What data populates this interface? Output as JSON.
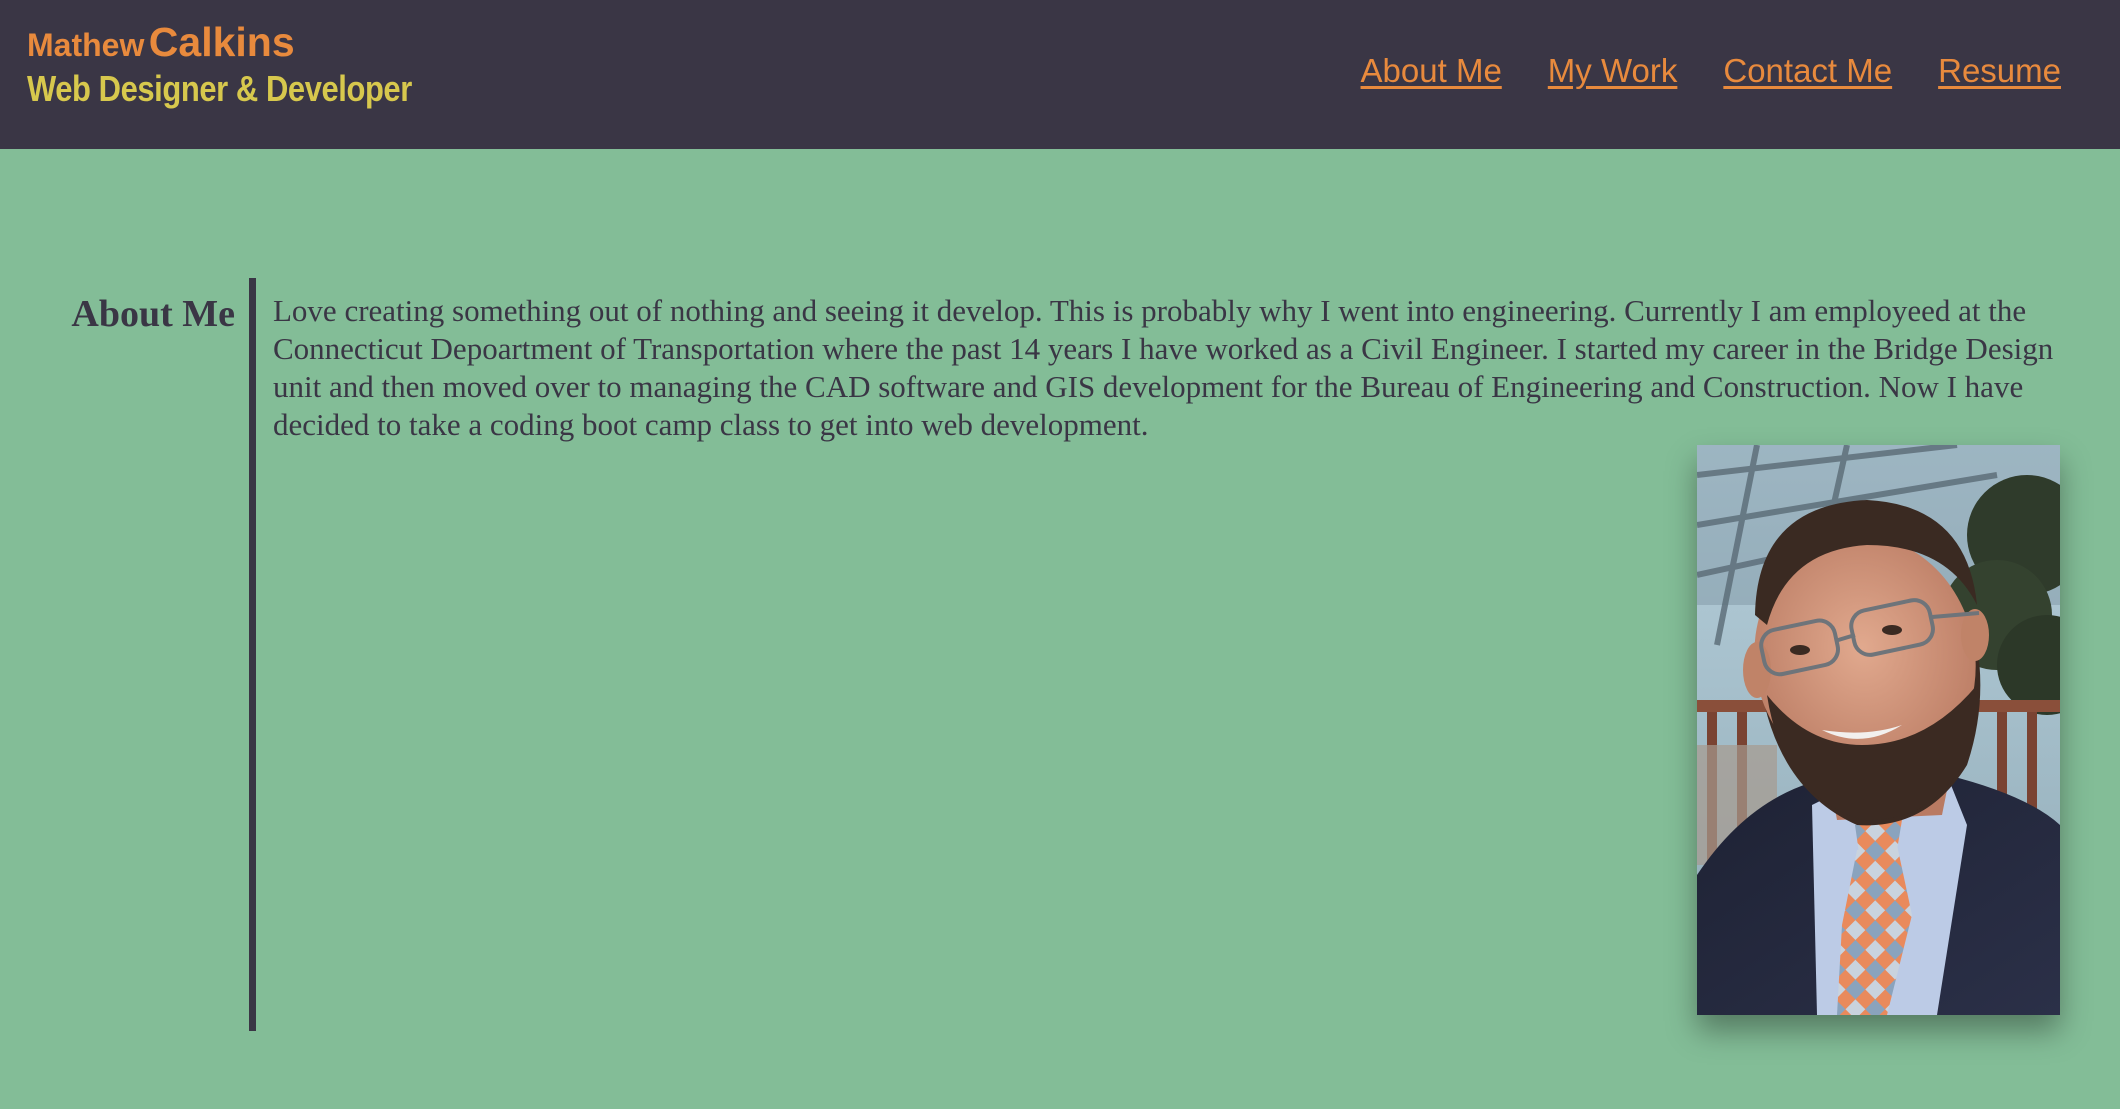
{
  "header": {
    "first_name": "Mathew",
    "last_name": "Calkins",
    "role": "Web Designer & Developer",
    "nav": [
      {
        "label": "About Me"
      },
      {
        "label": "My Work"
      },
      {
        "label": "Contact Me"
      },
      {
        "label": "Resume"
      }
    ]
  },
  "about": {
    "heading": "About Me",
    "text": "Love creating something out of nothing and seeing it develop. This is probably why I went into engineering. Currently I am employeed at the Connecticut Depoartment of Transportation where the past 14 years I have worked as a Civil Engineer. I started my career in the Bridge Design unit and then moved over to managing the CAD software and GIS development for the Bureau of Engineering and Construction. Now I have decided to take a coding boot camp class to get into web development."
  },
  "colors": {
    "header_bg": "#3a3645",
    "page_bg": "#83bd97",
    "accent_orange": "#e88a3d",
    "accent_yellow": "#d7c84d",
    "text_dark": "#3a3645"
  }
}
